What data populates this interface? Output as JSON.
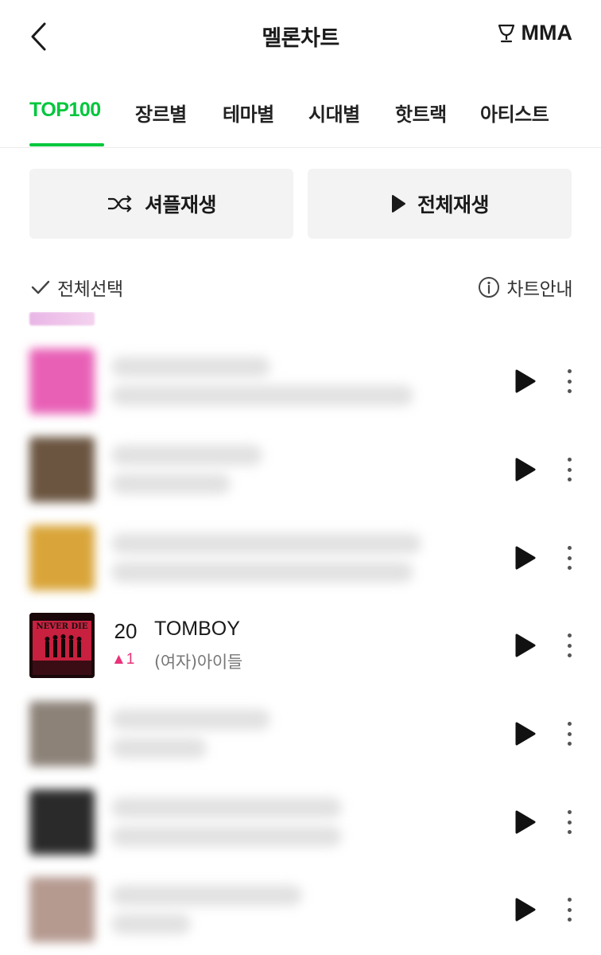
{
  "header": {
    "title": "멜론차트",
    "mma_label": "MMA"
  },
  "tabs": [
    {
      "label": "TOP100",
      "active": true
    },
    {
      "label": "장르별"
    },
    {
      "label": "테마별"
    },
    {
      "label": "시대별"
    },
    {
      "label": "핫트랙"
    },
    {
      "label": "아티스트"
    }
  ],
  "actions": {
    "shuffle_label": "셔플재생",
    "play_all_label": "전체재생"
  },
  "list_controls": {
    "select_all_label": "전체선택",
    "chart_info_label": "차트안내"
  },
  "songs": [
    {
      "rank": "20",
      "change": "▲1",
      "title": "TOMBOY",
      "artist": "(여자)아이들",
      "album_text": "NEVER DIE"
    }
  ],
  "colors": {
    "accent": "#00c73c",
    "rank_up": "#e8337a"
  }
}
